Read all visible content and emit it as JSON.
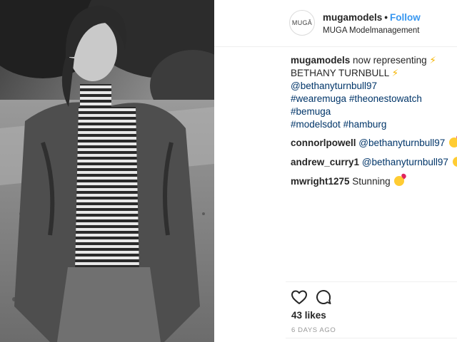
{
  "post": {
    "avatar_text": "MUGĀ",
    "username": "mugamodels",
    "separator": "•",
    "follow_label": "Follow",
    "location": "MUGA Modelmanagement"
  },
  "caption": {
    "username": "mugamodels",
    "text_part1": "now representing",
    "text_part2": "BETHANY TURNBULL",
    "emoji": "⚡",
    "mention": "@bethanyturnbull97",
    "hashtags": [
      "#wearemuga",
      "#theonestowatch",
      "#bemuga",
      "#modelsdot",
      "#hamburg"
    ]
  },
  "comments": [
    {
      "username": "connorlpowell",
      "mention": "@bethanyturnbull97",
      "text": ""
    },
    {
      "username": "andrew_curry1",
      "mention": "@bethanyturnbull97",
      "text": ""
    },
    {
      "username": "mwright1275",
      "mention": "",
      "text": "Stunning"
    }
  ],
  "actions": {
    "like_icon": "heart-outline-icon",
    "comment_icon": "comment-bubble-icon"
  },
  "likes_text": "43 likes",
  "timestamp": "6 DAYS AGO",
  "colors": {
    "follow": "#3897f0",
    "link": "#003569",
    "text": "#262626",
    "muted": "#999999"
  }
}
